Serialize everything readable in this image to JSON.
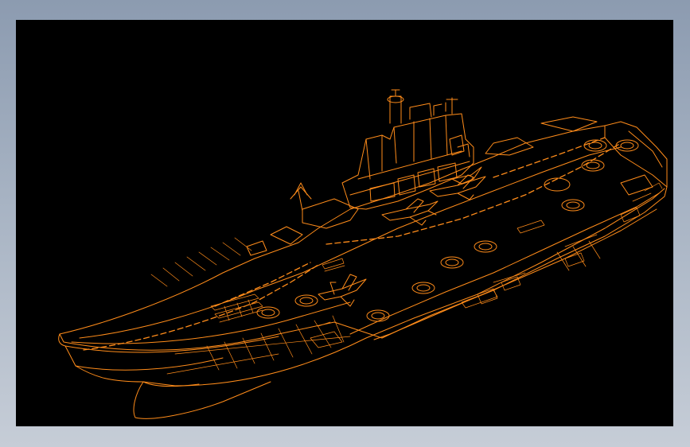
{
  "viewport": {
    "background": "#000000",
    "line_color": "#ff8c1a"
  },
  "subject": {
    "icon_name": "aircraft-carrier-wireframe"
  }
}
